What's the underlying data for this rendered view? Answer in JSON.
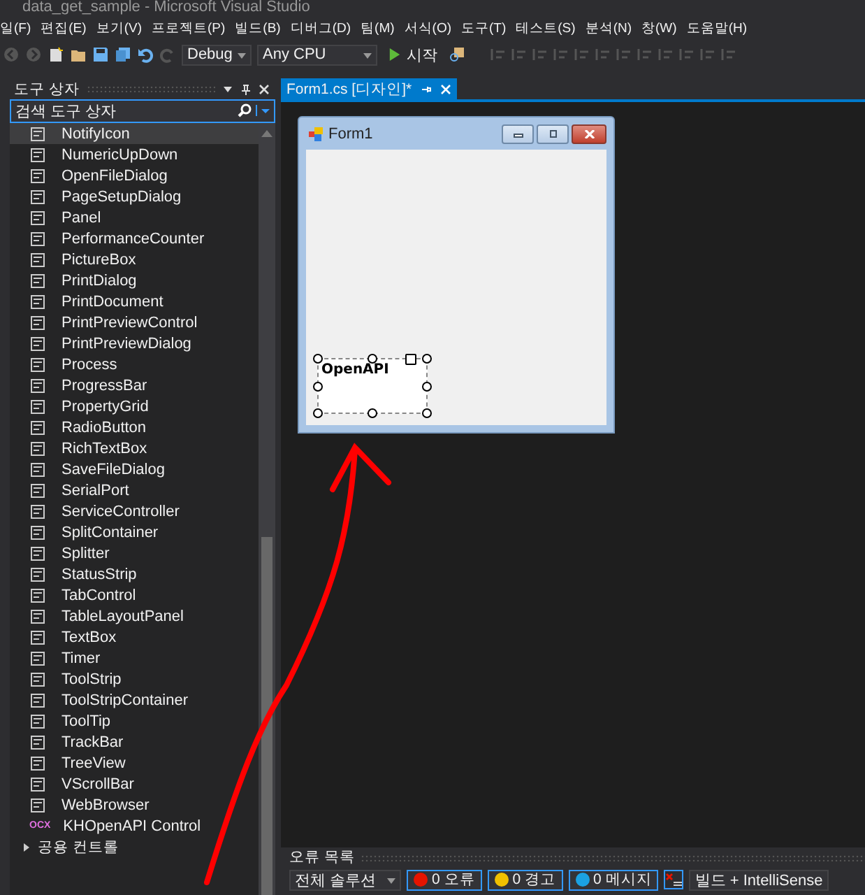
{
  "window": {
    "title": "data_get_sample - Microsoft Visual Studio"
  },
  "menu": [
    "일(F)",
    "편집(E)",
    "보기(V)",
    "프로젝트(P)",
    "빌드(B)",
    "디버그(D)",
    "팀(M)",
    "서식(O)",
    "도구(T)",
    "테스트(S)",
    "분석(N)",
    "창(W)",
    "도움말(H)"
  ],
  "toolbar": {
    "configuration": "Debug",
    "platform": "Any CPU",
    "start": "시작"
  },
  "toolbox": {
    "title": "도구 상자",
    "search": {
      "placeholder": "검색 도구 상자"
    },
    "items": [
      {
        "label": "NotifyIcon",
        "selected": true
      },
      {
        "label": "NumericUpDown",
        "selected": false
      },
      {
        "label": "OpenFileDialog",
        "selected": false
      },
      {
        "label": "PageSetupDialog",
        "selected": false
      },
      {
        "label": "Panel",
        "selected": false
      },
      {
        "label": "PerformanceCounter",
        "selected": false
      },
      {
        "label": "PictureBox",
        "selected": false
      },
      {
        "label": "PrintDialog",
        "selected": false
      },
      {
        "label": "PrintDocument",
        "selected": false
      },
      {
        "label": "PrintPreviewControl",
        "selected": false
      },
      {
        "label": "PrintPreviewDialog",
        "selected": false
      },
      {
        "label": "Process",
        "selected": false
      },
      {
        "label": "ProgressBar",
        "selected": false
      },
      {
        "label": "PropertyGrid",
        "selected": false
      },
      {
        "label": "RadioButton",
        "selected": false
      },
      {
        "label": "RichTextBox",
        "selected": false
      },
      {
        "label": "SaveFileDialog",
        "selected": false
      },
      {
        "label": "SerialPort",
        "selected": false
      },
      {
        "label": "ServiceController",
        "selected": false
      },
      {
        "label": "SplitContainer",
        "selected": false
      },
      {
        "label": "Splitter",
        "selected": false
      },
      {
        "label": "StatusStrip",
        "selected": false
      },
      {
        "label": "TabControl",
        "selected": false
      },
      {
        "label": "TableLayoutPanel",
        "selected": false
      },
      {
        "label": "TextBox",
        "selected": false
      },
      {
        "label": "Timer",
        "selected": false
      },
      {
        "label": "ToolStrip",
        "selected": false
      },
      {
        "label": "ToolStripContainer",
        "selected": false
      },
      {
        "label": "ToolTip",
        "selected": false
      },
      {
        "label": "TrackBar",
        "selected": false
      },
      {
        "label": "TreeView",
        "selected": false
      },
      {
        "label": "VScrollBar",
        "selected": false
      },
      {
        "label": "WebBrowser",
        "selected": false
      },
      {
        "label": "KHOpenAPI Control",
        "selected": false,
        "badge": "OCX"
      }
    ],
    "group": "공용 컨트롤"
  },
  "document_tab": {
    "label": "Form1.cs [디자인]*",
    "selected": true
  },
  "form": {
    "title": "Form1",
    "control": {
      "label": "OpenAPI"
    }
  },
  "error_list": {
    "title": "오류 목록",
    "scope": "전체 솔루션",
    "filters": [
      {
        "label": "0 오류",
        "kind": "error"
      },
      {
        "label": "0 경고",
        "kind": "warning"
      },
      {
        "label": "0 메시지",
        "kind": "info"
      }
    ],
    "source": "빌드 + IntelliSense"
  }
}
